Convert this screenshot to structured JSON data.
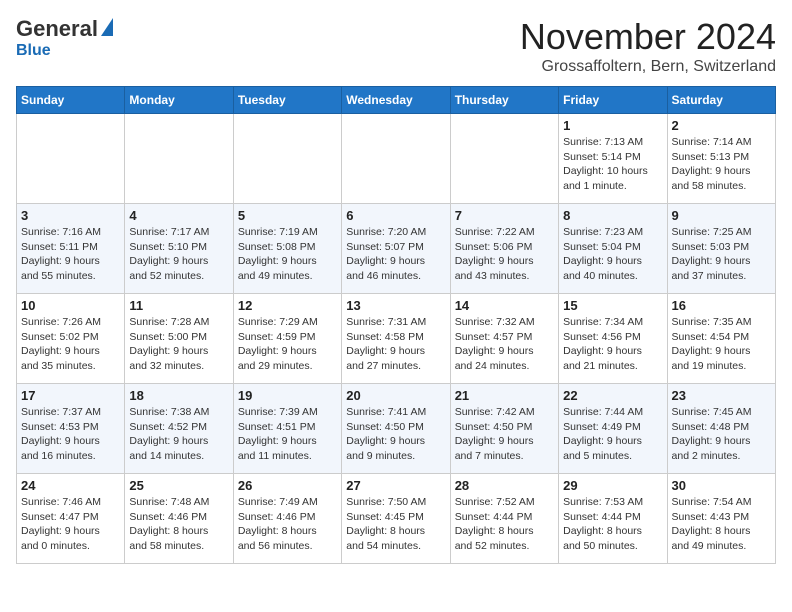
{
  "header": {
    "logo_general": "General",
    "logo_blue": "Blue",
    "month_title": "November 2024",
    "subtitle": "Grossaffoltern, Bern, Switzerland"
  },
  "weekdays": [
    "Sunday",
    "Monday",
    "Tuesday",
    "Wednesday",
    "Thursday",
    "Friday",
    "Saturday"
  ],
  "weeks": [
    [
      {
        "day": "",
        "info": ""
      },
      {
        "day": "",
        "info": ""
      },
      {
        "day": "",
        "info": ""
      },
      {
        "day": "",
        "info": ""
      },
      {
        "day": "",
        "info": ""
      },
      {
        "day": "1",
        "info": "Sunrise: 7:13 AM\nSunset: 5:14 PM\nDaylight: 10 hours\nand 1 minute."
      },
      {
        "day": "2",
        "info": "Sunrise: 7:14 AM\nSunset: 5:13 PM\nDaylight: 9 hours\nand 58 minutes."
      }
    ],
    [
      {
        "day": "3",
        "info": "Sunrise: 7:16 AM\nSunset: 5:11 PM\nDaylight: 9 hours\nand 55 minutes."
      },
      {
        "day": "4",
        "info": "Sunrise: 7:17 AM\nSunset: 5:10 PM\nDaylight: 9 hours\nand 52 minutes."
      },
      {
        "day": "5",
        "info": "Sunrise: 7:19 AM\nSunset: 5:08 PM\nDaylight: 9 hours\nand 49 minutes."
      },
      {
        "day": "6",
        "info": "Sunrise: 7:20 AM\nSunset: 5:07 PM\nDaylight: 9 hours\nand 46 minutes."
      },
      {
        "day": "7",
        "info": "Sunrise: 7:22 AM\nSunset: 5:06 PM\nDaylight: 9 hours\nand 43 minutes."
      },
      {
        "day": "8",
        "info": "Sunrise: 7:23 AM\nSunset: 5:04 PM\nDaylight: 9 hours\nand 40 minutes."
      },
      {
        "day": "9",
        "info": "Sunrise: 7:25 AM\nSunset: 5:03 PM\nDaylight: 9 hours\nand 37 minutes."
      }
    ],
    [
      {
        "day": "10",
        "info": "Sunrise: 7:26 AM\nSunset: 5:02 PM\nDaylight: 9 hours\nand 35 minutes."
      },
      {
        "day": "11",
        "info": "Sunrise: 7:28 AM\nSunset: 5:00 PM\nDaylight: 9 hours\nand 32 minutes."
      },
      {
        "day": "12",
        "info": "Sunrise: 7:29 AM\nSunset: 4:59 PM\nDaylight: 9 hours\nand 29 minutes."
      },
      {
        "day": "13",
        "info": "Sunrise: 7:31 AM\nSunset: 4:58 PM\nDaylight: 9 hours\nand 27 minutes."
      },
      {
        "day": "14",
        "info": "Sunrise: 7:32 AM\nSunset: 4:57 PM\nDaylight: 9 hours\nand 24 minutes."
      },
      {
        "day": "15",
        "info": "Sunrise: 7:34 AM\nSunset: 4:56 PM\nDaylight: 9 hours\nand 21 minutes."
      },
      {
        "day": "16",
        "info": "Sunrise: 7:35 AM\nSunset: 4:54 PM\nDaylight: 9 hours\nand 19 minutes."
      }
    ],
    [
      {
        "day": "17",
        "info": "Sunrise: 7:37 AM\nSunset: 4:53 PM\nDaylight: 9 hours\nand 16 minutes."
      },
      {
        "day": "18",
        "info": "Sunrise: 7:38 AM\nSunset: 4:52 PM\nDaylight: 9 hours\nand 14 minutes."
      },
      {
        "day": "19",
        "info": "Sunrise: 7:39 AM\nSunset: 4:51 PM\nDaylight: 9 hours\nand 11 minutes."
      },
      {
        "day": "20",
        "info": "Sunrise: 7:41 AM\nSunset: 4:50 PM\nDaylight: 9 hours\nand 9 minutes."
      },
      {
        "day": "21",
        "info": "Sunrise: 7:42 AM\nSunset: 4:50 PM\nDaylight: 9 hours\nand 7 minutes."
      },
      {
        "day": "22",
        "info": "Sunrise: 7:44 AM\nSunset: 4:49 PM\nDaylight: 9 hours\nand 5 minutes."
      },
      {
        "day": "23",
        "info": "Sunrise: 7:45 AM\nSunset: 4:48 PM\nDaylight: 9 hours\nand 2 minutes."
      }
    ],
    [
      {
        "day": "24",
        "info": "Sunrise: 7:46 AM\nSunset: 4:47 PM\nDaylight: 9 hours\nand 0 minutes."
      },
      {
        "day": "25",
        "info": "Sunrise: 7:48 AM\nSunset: 4:46 PM\nDaylight: 8 hours\nand 58 minutes."
      },
      {
        "day": "26",
        "info": "Sunrise: 7:49 AM\nSunset: 4:46 PM\nDaylight: 8 hours\nand 56 minutes."
      },
      {
        "day": "27",
        "info": "Sunrise: 7:50 AM\nSunset: 4:45 PM\nDaylight: 8 hours\nand 54 minutes."
      },
      {
        "day": "28",
        "info": "Sunrise: 7:52 AM\nSunset: 4:44 PM\nDaylight: 8 hours\nand 52 minutes."
      },
      {
        "day": "29",
        "info": "Sunrise: 7:53 AM\nSunset: 4:44 PM\nDaylight: 8 hours\nand 50 minutes."
      },
      {
        "day": "30",
        "info": "Sunrise: 7:54 AM\nSunset: 4:43 PM\nDaylight: 8 hours\nand 49 minutes."
      }
    ]
  ]
}
